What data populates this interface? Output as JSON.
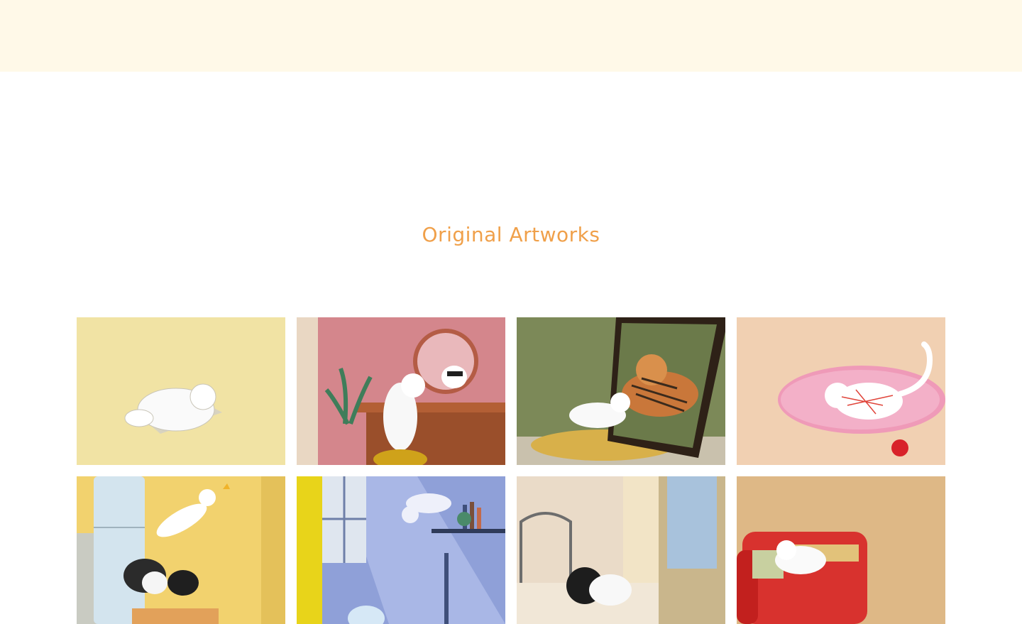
{
  "page": {
    "title": "Original Artworks",
    "colors": {
      "banner_background": "#fff9e8",
      "title_color": "#f0a04a"
    }
  },
  "gallery": {
    "artworks": [
      {
        "subject": "white cat sleeping on newspaper",
        "background": "#f1e3a4"
      },
      {
        "subject": "white cat looking at masked reflection in round mirror",
        "background": "#d4868c"
      },
      {
        "subject": "white cat and tiger reflection in standing mirror",
        "background": "#7c8958"
      },
      {
        "subject": "white cat tangled in red yarn on pink rug",
        "background": "#f1d0b2"
      },
      {
        "subject": "white cat leaping at butterfly in kitchen",
        "background": "#f2d26e"
      },
      {
        "subject": "white cat jumping by window and fishbowl",
        "background": "#8fa0d8"
      },
      {
        "subject": "black cat and white cat by bedroom window",
        "background": "#eadbc8"
      },
      {
        "subject": "white cat resting on red sofa",
        "background": "#deb886"
      }
    ]
  }
}
